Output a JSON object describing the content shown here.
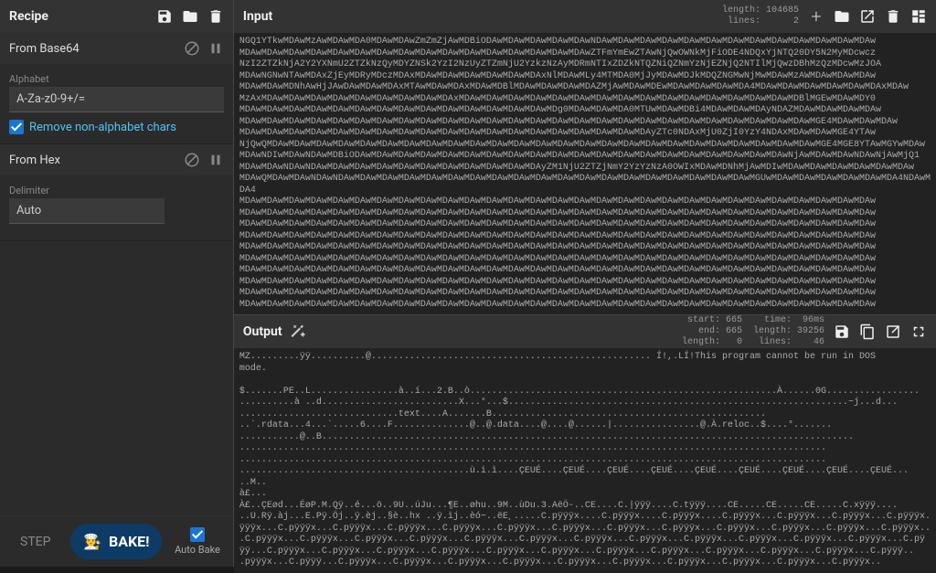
{
  "recipe": {
    "title": "Recipe",
    "operations": [
      {
        "name": "From Base64",
        "fields": {
          "alphabet_label": "Alphabet",
          "alphabet_value": "A-Za-z0-9+/=",
          "remove_label": "Remove non-alphabet chars"
        }
      },
      {
        "name": "From Hex",
        "fields": {
          "delimiter_label": "Delimiter",
          "delimiter_value": "Auto"
        }
      }
    ]
  },
  "footer": {
    "step": "STEP",
    "bake": "BAKE!",
    "auto_bake": "Auto Bake"
  },
  "input": {
    "title": "Input",
    "stats": "length: 104685\n lines:      2",
    "text": "NGQ1YTkwMDAwMzAwMDAwMDA0MDAwMDAwZmZmZjAwMDBiODAwMDAwMDAwMDAwMDAwNDAwMDAwMDAwMDAwMDAwMDAwMDAwMDAwMDAwMDAwMDAwMDAwMDAw\nMDAwMDAwMDAwMDAwMDAwMDAwMDAwMDAwMDAwMDAwMDAwMDAwMDAwMDAwMDAwMDAwZTFmYmEwZTAwNjQwOWNkMjFiODE4NDQxYjNTQ20DY5N2MyMDcwcz\nNzI2ZTZkNjA2Y2YXNmU2ZTZkNzQyMDYZNSk2YzI2NzUyZTZmNjU2YzkzNzAyMDRmNTIxZDZkNTQZNiQZNmYzNjEZNjQ2NTIlMjQwzDBhMzQzMDcwMzJOA\nMDAwNGNwNTAwMDAxZjEyMDRyMDczMDAxMDAwMDAwMDAwMDAwMDAwMDAxNlMDAwMLy4MTMDA0MjJyMDAwMDJkMDQZNGMwNjMwMDAwMzAWMDAwMDAwMDAw\nMDAwMDAwMDNhAwHjJAwDAwMDAwMDAxMTAwMDAwMDAxMDAwMDBlMDAwMDAwMDAwMDAZMjAwMDAwMDEwMDAwMDAwMDAwMDA4MDAwMDAwMDAwMDAwMDAwMDAxMDAw\nMzAxMDAwMDAwMDAwMDAwMDAwMDAwMDAwMDAwMDAxMDAwMDAwMDAwMDAwMDAwMDAwMDAwMDAwMDAwMDAwMDAwMDAwMDAwMDAwMDAwMDBlMGEwMDAwMDY0\nMDAwMDAwMDAwMDAwMDAwMDAwMDAwMDAwMDAwMDAwMDAwMDAwMDAwMDAwMDg0MDAwMDAwMDA0MTUwMDAwMDBi4MDAwMDAwMDAyNDAZMDAwMDAwMDAwMDAw\nMDAwMDAwMDAwMDAwMDAwMDAwMDAwMDAwMDAwMDAwMDAwMDAwMDAwMDAwMDAwMDAwMDAwMDAwMDAwMDAwMDAwMDAwMDAwMDAwMDAwMDAwMGE4MDAwMDAwMDAw\nMDAwMDAwMDAwMDAwMDAwMDAwMDAwMDAwMDAwMDAwMDAwMDAwMDAwMDAwMDAwMDAwMDAwMDAwMDAyZTc0NDAxMjU0ZjI0YzY4NDAxMDAwMDAwMGE4YTAw\nNjQwQMDAwMDAwMDAwMDAwMDAwMDAwMDAwMDAwMDAwMDAwMDAwMDAwMDAwMDAwMDAwMDAwMDAwMDAwMDAwMDAwMDAwMDAwMDAwMDAwMDAwMGE4MGE8YTAwMGYwMDAw\nMDAwNDIwMDAwNDAwMDBiODAwMDAwMDAwMDAwMDAwMDAwMDAwMDAwMDAwMDAwMDAwMDAwMDAwMDAwMDAwMDAwMDAwMDAwMDAwMDAwNjAwMDAwMDAwNDAwNjAwMjQ1\nMDAwMDAwNDAwNDAwMDAwMDAwMDAwMDAwMDAwMDAwMDAwMDAwMDAwMDAyZM1NjU2ZTZjNmY2YzYzNzA0OWIxMDAwMDNhMjAwMDIwMDAwMDAwMDAwMDAwMDAwMDAw\nMDAwQMDAwMDAwNDAwNDAwMDAwMDAwMDAwMDAwMDAwMDAwMDAwMDAwMDAwMDAwMDAwMDAwMDAwMDAwMDAwMDAwMDAwMDAwMGUwMDAwMDAwMDAwMDAwMDAwMDA4NDAwMDA4\nMDAwMDAwMDAwMDAwMDAwMDAwMDAwMDAwMDAwMDAwMDAwMDAwMDAwMDAwMDAwMDAwMDAwMDAwMDAwMDAwMDAwMDAwMDAwMDAwMDAwMDAwMDAwMDAwMDAw\nMDAwMDAwMDAwMDAwMDAwMDAwMDAwMDAwMDAwMDAwMDAwMDAwMDAwMDAwMDAwMDAwMDAwMDAwMDAwMDAwMDAwMDAwMDAwMDAwMDAwMDAwMDAwMDAwMDAw\nMDAwMDAwMDAwMDAwMDAwMDAwMDAwMDAwMDAwMDAwMDAwMDAwMDAwMDAwMDAwMDAwMDAwMDAwMDAwMDAwMDAwMDAwMDAwMDAwMDAwMDAwMDAwMDAwMDAw\nMDAwMDAwMDAwMDAwMDAwMDAwMDAwMDAwMDAwMDAwMDAwMDAwMDAwMDAwMDAwMDAwMDAwMDAwMDAwMDAwMDAwMDAwMDAwMDAwMDAwMDAwMDAwMDAwMDAw\nMDAwMDAwMDAwMDAwMDAwMDAwMDAwMDAwMDAwMDAwMDAwMDAwMDAwMDAwMDAwMDAwMDAwMDAwMDAwMDAwMDAwMDAwMDAwMDAwMDAwMDAwMDAwMDAwMDAw\nMDAwMDAwMDAwMDAwMDAwMDAwMDAwMDAwMDAwMDAwMDAwMDAwMDAwMDAwMDAwMDAwMDAwMDAwMDAwMDAwMDAwMDAwMDAwMDAwMDAwMDAwMDAwMDAwMDAw\nMDAwMDAwMDAwMDAwMDAwMDAwMDAwMDAwMDAwMDAwMDAwMDAwMDAwMDAwMDAwMDAwMDAwMDAwMDAwMDAwMDAwMDAwMDAwMDAwMDAwMDAwMDAwMDAwMDAw\nMDAwMDAwMDAwMDAwMDAwMDAwMDAwMDAwMDAwMDAwMDAwMDAwMDAwMDAwMDAwMDAwMDAwMDAwMDAwMDAwMDAwMDAwMDAwMDAwMDAwMDAwMDAwMDAwMDAw\nMDAwMDAwMDAwMDAwMDAwMDAwMDAwMDAwMDAwMDAwMDAwMDAwMDAwMDAwMDAwMDAwMDAwMDAwMDAwMDAwMDAwMDAwMDAwMDAwMDAwMDAwMDAwMDAwMDAw\nMDAwMDAwMDAwMDAwMDAwMDAwMDAwMDAwMDAwMDAwMDAwMDAwMDAwMDAwMDAwMDAwMDAwMDAwMDAwMDAwMDAwMDAwMDAwMDAwMDAwMDAwMDAwMDAwMDAw"
  },
  "output": {
    "title": "Output",
    "stats": "start: 665    time:  96ms\n  end: 665  length: 39256\nlength:   0   lines:    46",
    "text": "MZ.........ÿÿ..........@................................................... Í!,.LÍ!This program cannot be run in DOS\nmode.\n\n$.......PE..L................à..í...2.B..ò........................................................À......0G.................\n..........à ..d.........................X...°...$..............................................................~j...d...\n.............................text....A.......B..................................................\n..`.rdata...4...`.....6....F..............@..@.data....@....@......|................@.À.reloc..$....°.......\n...........@..B.................................................................................................\n...........................................................................................................\n...........................................................................................................\n..........................................ù.i.ì....ÇEUÉ....ÇEUÉ....ÇEUÉ....ÇEUÉ....ÇEUÉ....ÇEUÉ....ÇEUÉ....ÇEUÉ....ÇEUÉ...\n..M..\nà£...\nÀ£..ÇEød...ÉøP.M.Qÿ..é...ö..9U..úJu...¶E..øhu..9M..ùDu.3.AëÖ-..CE....C.|ÿÿÿ....C.tÿÿÿ....CE.....CE.....CE.....C.xÿÿÿ....\n..U.Rÿ.àj...E.Pÿ.Öj..ÿ.èj..§è..hx ..ÿ.ìj..èó~..ëE¸.....C.pÿÿÿx....C.pÿÿÿx....C.pÿÿÿx....C.pÿÿÿx...C.pÿÿÿx...C.pÿÿÿx...C.pÿÿÿx.\nÿÿÿx...C.pÿÿÿx...C.pÿÿÿx...C.pÿÿÿx...C.pÿÿÿx...C.pÿÿÿx...C.pÿÿÿx...C.pÿÿÿx...C.pÿÿÿx...C.pÿÿÿx...C.pÿÿÿx...C.pÿÿÿx...C.pÿÿÿx..\n.C.pÿÿÿx...C.pÿÿÿx...C.pÿÿÿx...C.pÿÿÿx...C.pÿÿÿx...C.pÿÿÿx...C.pÿÿÿx...C.pÿÿÿx...C.pÿÿÿx...C.pÿÿÿx...C.pÿÿÿx...C.pÿÿÿx...C.pÿ\nÿÿ...C.pÿÿÿx...C.pÿÿÿx...C.pÿÿÿx...C.pÿÿÿx...C.pÿÿÿx...C.pÿÿÿx...C.pÿÿÿx...C.pÿÿÿx...C.pÿÿÿx...C.pÿÿÿx...C.pÿÿÿx...C.pÿÿÿ..\n.pÿÿÿx...C.pÿÿÿ...C.pÿÿÿx...C.pÿÿÿx...C.pÿÿÿx...C.pÿÿÿx...C.pÿÿÿx...C.pÿÿÿx...C.pÿÿÿx...C.pÿÿÿx...C.pÿÿÿx...C.pÿÿÿx.."
  }
}
